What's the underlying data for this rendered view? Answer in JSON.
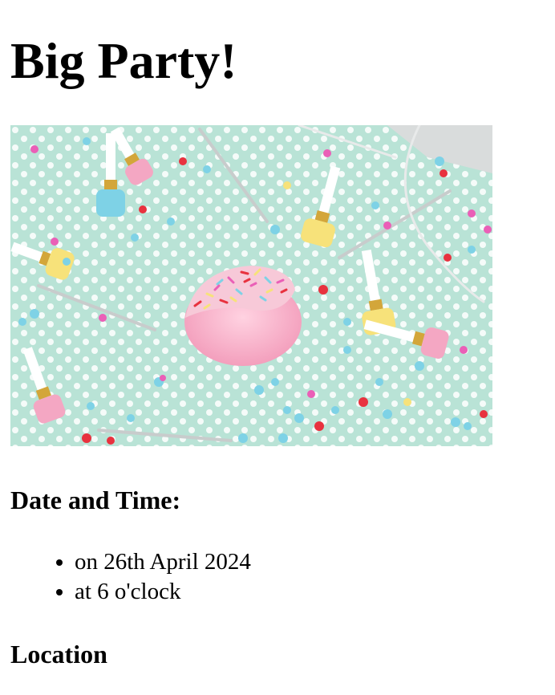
{
  "page": {
    "title": "Big Party!",
    "date_time_heading": "Date and Time:",
    "details": [
      "on 26th April 2024",
      "at 6 o'clock"
    ],
    "location_heading": "Location"
  },
  "image": {
    "subject": "party confetti with pink sprinkled donut, party blowers and candles",
    "colors": {
      "background": "#b9e3d6",
      "dot": "#ffffff",
      "pink": "#f4a7c3",
      "yellow": "#f7e27a",
      "blue": "#7ed2e6",
      "red": "#e8323f",
      "magenta": "#ea5fb7",
      "gold": "#d3a63a"
    }
  }
}
